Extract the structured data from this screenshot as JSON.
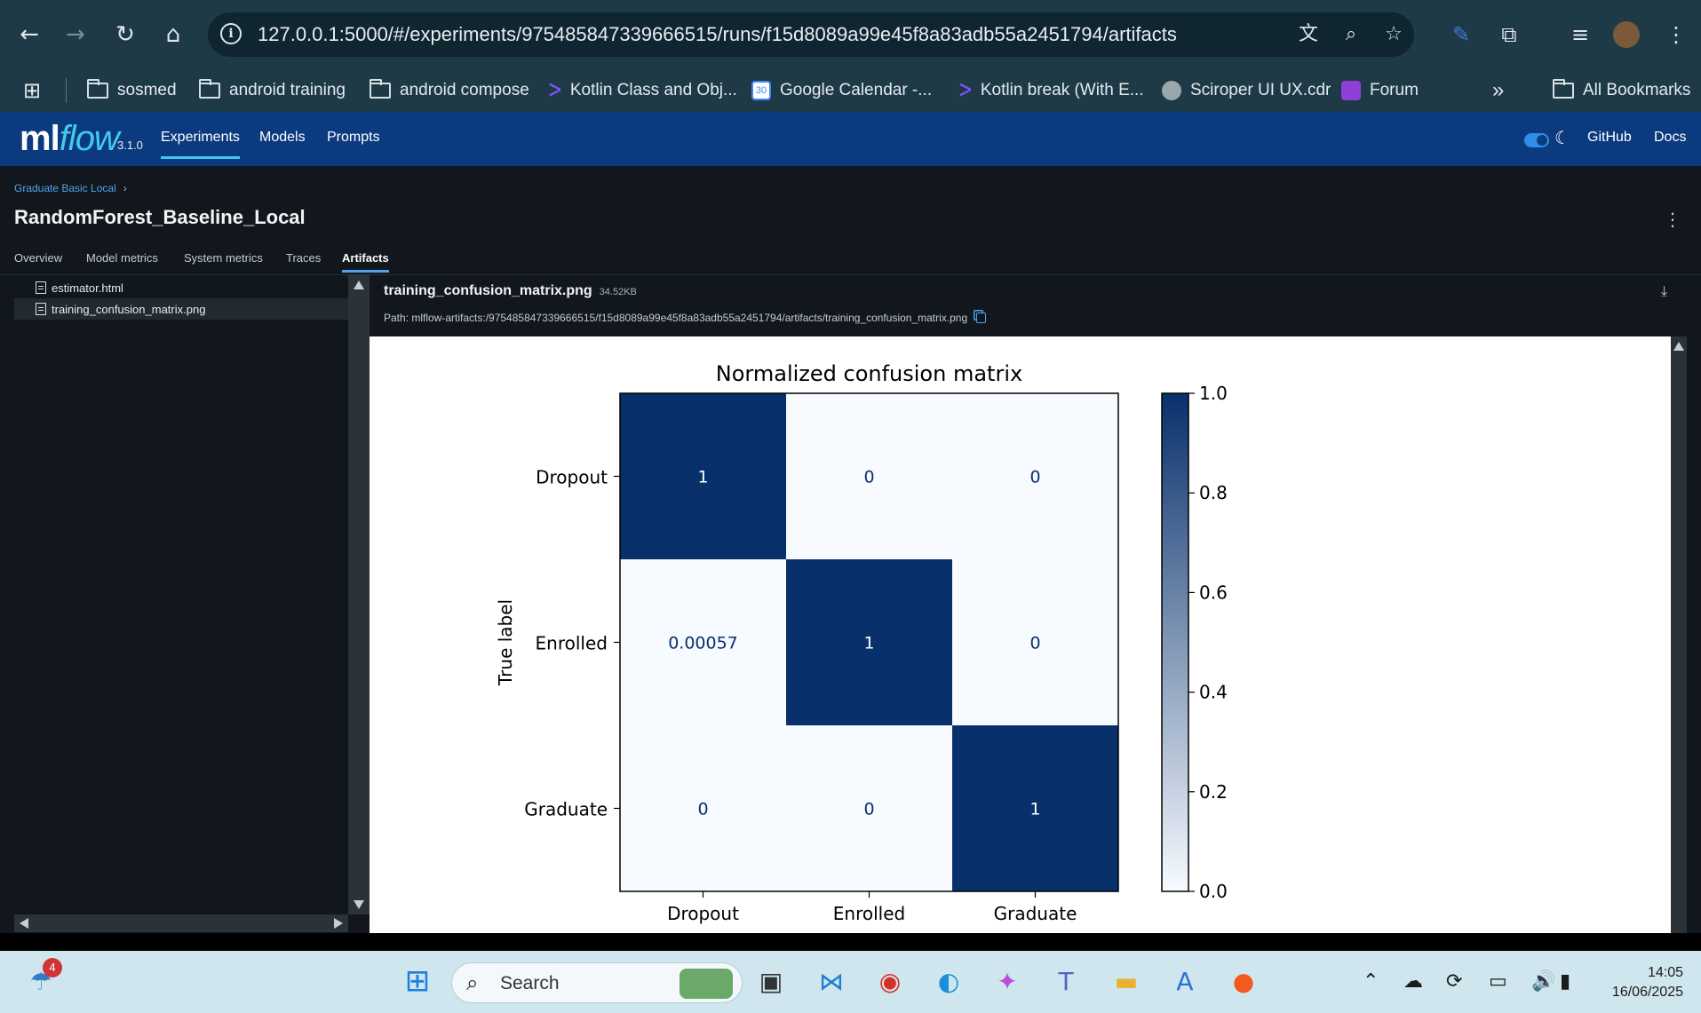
{
  "browser": {
    "url": "127.0.0.1:5000/#/experiments/975485847339666515/runs/f15d8089a99e45f8a83adb55a2451794/artifacts",
    "bookmarks": [
      {
        "label": "sosmed",
        "icon": "folder-icon"
      },
      {
        "label": "android training",
        "icon": "folder-icon"
      },
      {
        "label": "android compose",
        "icon": "folder-icon"
      },
      {
        "label": "Kotlin Class and Obj...",
        "icon": "kotlin-icon"
      },
      {
        "label": "Google Calendar -...",
        "icon": "calendar-icon"
      },
      {
        "label": "Kotlin break (With E...",
        "icon": "kotlin-icon"
      },
      {
        "label": "Sciroper UI UX.cdr",
        "icon": "globe-icon"
      },
      {
        "label": "Forum",
        "icon": "forum-icon"
      }
    ],
    "more_label": "»",
    "all_bookmarks": "All Bookmarks"
  },
  "mlflow": {
    "logo_ml": "ml",
    "logo_flow": "flow",
    "version": "3.1.0",
    "nav": [
      "Experiments",
      "Models",
      "Prompts"
    ],
    "right_links": [
      "GitHub",
      "Docs"
    ],
    "breadcrumb": "Graduate Basic Local",
    "run_title": "RandomForest_Baseline_Local",
    "tabs": [
      "Overview",
      "Model metrics",
      "System metrics",
      "Traces",
      "Artifacts"
    ],
    "active_tab": "Artifacts",
    "files": [
      "estimator.html",
      "training_confusion_matrix.png"
    ],
    "artifact": {
      "name": "training_confusion_matrix.png",
      "size": "34.52KB",
      "path": "Path: mlflow-artifacts:/975485847339666515/f15d8089a99e45f8a83adb55a2451794/artifacts/training_confusion_matrix.png"
    }
  },
  "chart_data": {
    "type": "heatmap",
    "title": "Normalized confusion matrix",
    "ylabel": "True label",
    "xlabel": "",
    "x_categories": [
      "Dropout",
      "Enrolled",
      "Graduate"
    ],
    "y_categories": [
      "Dropout",
      "Enrolled",
      "Graduate"
    ],
    "values": [
      [
        1,
        0,
        0
      ],
      [
        0.00057,
        1,
        0
      ],
      [
        0,
        0,
        1
      ]
    ],
    "cell_labels": [
      [
        "1",
        "0",
        "0"
      ],
      [
        "0.00057",
        "1",
        "0"
      ],
      [
        "0",
        "0",
        "1"
      ]
    ],
    "colorbar_ticks": [
      "0.0",
      "0.2",
      "0.4",
      "0.6",
      "0.8",
      "1.0"
    ],
    "colorbar_range": [
      0,
      1
    ],
    "colormap": "Blues",
    "low_color": "#f7fbff",
    "high_color": "#08306b"
  },
  "taskbar": {
    "search_placeholder": "Search",
    "time": "14:05",
    "date": "16/06/2025",
    "notification_count": "4"
  }
}
